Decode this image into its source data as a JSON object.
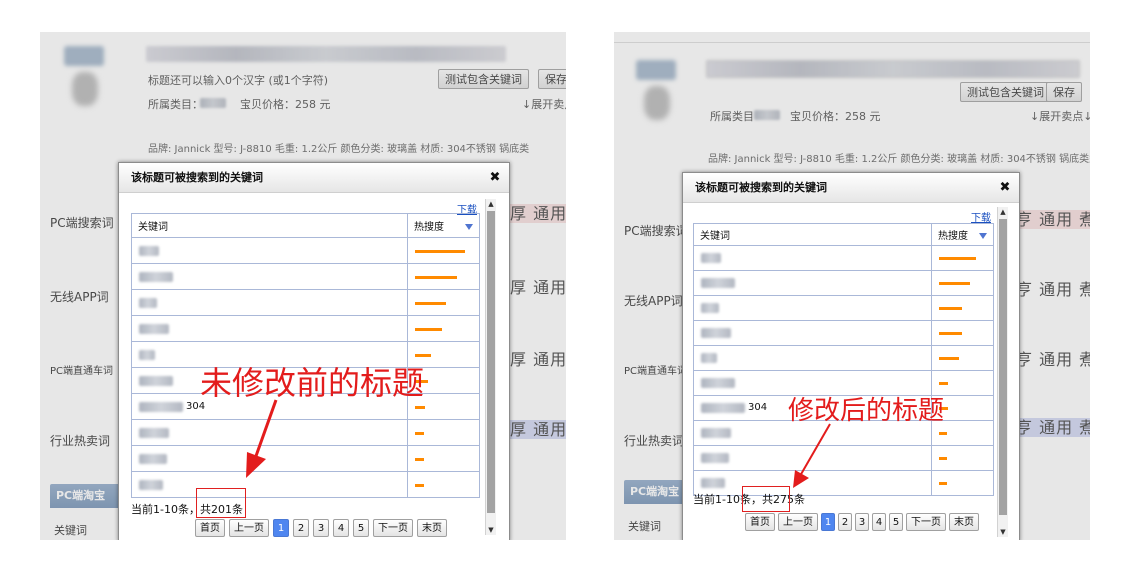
{
  "left": {
    "title_hint": "标题还可以输入0个汉字 (或1个字符)",
    "test_button": "测试包含关键词",
    "save_button": "保存",
    "category_label": "所属类目：",
    "price_text": "宝贝价格：258 元",
    "expand_link": "↓展开卖点",
    "attributes_text": "品牌: Jannick 型号: J-8810 毛重: 1.2公斤 颜色分类: 玻璃盖 材质: 304不锈钢 锅底类",
    "side_labels": [
      "PC端搜索词",
      "无线APP词",
      "PC端直通车词",
      "行业热卖词"
    ],
    "right_texts": [
      "厚 通用",
      "厚 通用",
      "厚 通用",
      "厚 通用"
    ],
    "bottom_tab": "PC端淘宝搜",
    "bottom_label": "关键词",
    "dialog": {
      "title": "该标题可被搜索到的关键词",
      "close": "✖",
      "download": "下载",
      "col_keyword": "关键词",
      "col_heat": "热搜度",
      "rows": [
        {
          "extra": "",
          "heat": 0.86
        },
        {
          "extra": "",
          "heat": 0.72
        },
        {
          "extra": "",
          "heat": 0.54
        },
        {
          "extra": "",
          "heat": 0.46
        },
        {
          "extra": "",
          "heat": 0.28
        },
        {
          "extra": "",
          "heat": 0.22
        },
        {
          "extra": "304",
          "heat": 0.18
        },
        {
          "extra": "",
          "heat": 0.16
        },
        {
          "extra": "",
          "heat": 0.16
        },
        {
          "extra": "",
          "heat": 0.16
        }
      ],
      "summary_prefix": "当前1-10条",
      "summary_total": "，共201条",
      "pager": [
        "首页",
        "上一页",
        "1",
        "2",
        "3",
        "4",
        "5",
        "下一页",
        "末页"
      ]
    },
    "annotation": "未修改前的标题"
  },
  "right": {
    "test_button": "测试包含关键词",
    "save_button": "保存",
    "category_label": "所属类目",
    "price_text": "宝贝价格：258 元",
    "expand_link": "↓展开卖点↓",
    "attributes_text": "品牌: Jannick 型号: J-8810 毛重: 1.2公斤 颜色分类: 玻璃盖 材质: 304不锈钢 锅底类型: !",
    "side_labels": [
      "PC端搜索词",
      "无线APP词",
      "PC端直通车词",
      "行业热卖词"
    ],
    "right_texts": [
      "亨 通用 煮",
      "亨 通用 煮",
      "亨 通用 煮",
      "亨 通用 煮"
    ],
    "bottom_tab": "PC端淘宝搜",
    "bottom_label": "关键词",
    "dialog": {
      "title": "该标题可被搜索到的关键词",
      "close": "✖",
      "download": "下载",
      "col_keyword": "关键词",
      "col_heat": "热搜度",
      "rows": [
        {
          "extra": "",
          "heat": 0.72
        },
        {
          "extra": "",
          "heat": 0.6
        },
        {
          "extra": "",
          "heat": 0.44
        },
        {
          "extra": "",
          "heat": 0.44
        },
        {
          "extra": "",
          "heat": 0.38
        },
        {
          "extra": "",
          "heat": 0.18
        },
        {
          "extra": "304",
          "heat": 0.18
        },
        {
          "extra": "",
          "heat": 0.16
        },
        {
          "extra": "",
          "heat": 0.16
        },
        {
          "extra": "",
          "heat": 0.16
        }
      ],
      "summary_prefix": "当前1-10条",
      "summary_total": "，共275条",
      "pager": [
        "首页",
        "上一页",
        "1",
        "2",
        "3",
        "4",
        "5",
        "下一页",
        "末页"
      ]
    },
    "annotation": "修改后的标题"
  },
  "colors": {
    "accent": "#ff8a00",
    "annotation": "#e31c1c",
    "pager_active": "#4f86f0",
    "link": "#1a50c0"
  }
}
